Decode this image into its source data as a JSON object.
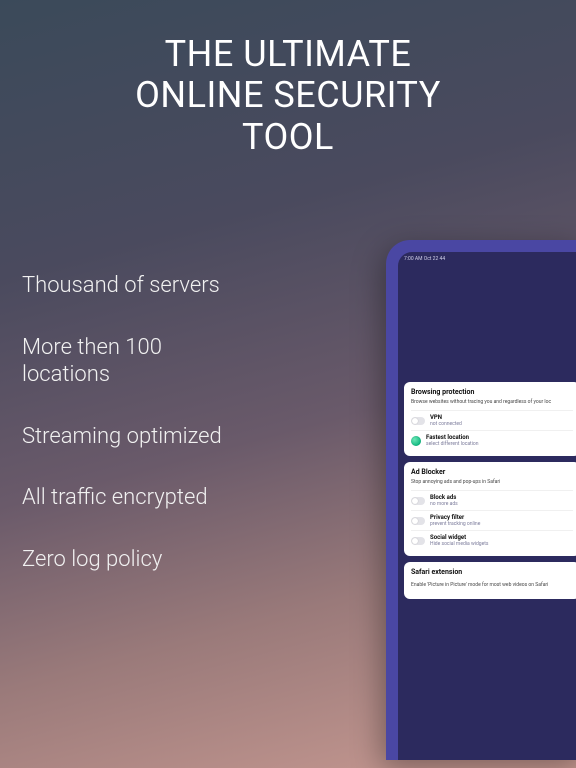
{
  "headline": {
    "line1": "THE ULTIMATE",
    "line2": "ONLINE SECURITY",
    "line3": "TOOL"
  },
  "features": [
    "Thousand of servers",
    "More then 100 locations",
    "Streaming optimized",
    "All traffic encrypted",
    "Zero log policy"
  ],
  "tablet": {
    "statusbar": "7:00 AM  Oct 22 44",
    "cards": {
      "browsing": {
        "title": "Browsing protection",
        "subtitle": "Browse websites without tracing you and regardless of your loc",
        "vpn": {
          "title": "VPN",
          "subtitle": "not connected"
        },
        "fastest": {
          "title": "Fastest location",
          "subtitle": "select different location"
        }
      },
      "adblocker": {
        "title": "Ad Blocker",
        "subtitle": "Stop annoying ads and pop-ups in Safari",
        "blockads": {
          "title": "Block ads",
          "subtitle": "no more ads"
        },
        "privacy": {
          "title": "Privacy filter",
          "subtitle": "prevent tracking online"
        },
        "social": {
          "title": "Social widget",
          "subtitle": "Hide social media widgets"
        }
      },
      "safari": {
        "title": "Safari extension",
        "subtitle": "Enable 'Picture in Picture' mode for most web videos on Safari"
      }
    }
  }
}
